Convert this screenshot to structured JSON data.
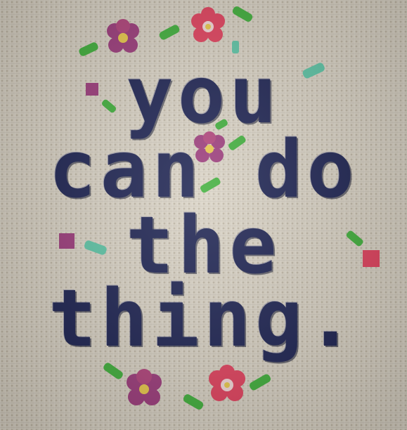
{
  "embroidery": {
    "lines": [
      "you",
      "can do",
      "the",
      "thing."
    ],
    "thread_colors": {
      "text": "#1b2150",
      "magenta": "#b0427a",
      "purple": "#9b3a7a",
      "pink_red": "#e0405c",
      "yellow": "#e8c84a",
      "leaf_green": "#3fae3a",
      "mint": "#5cc3a4",
      "fabric": "#d9d2c4"
    },
    "motifs": [
      "flower-icon",
      "leaf-icon",
      "cross-stitch-dot-icon"
    ]
  }
}
